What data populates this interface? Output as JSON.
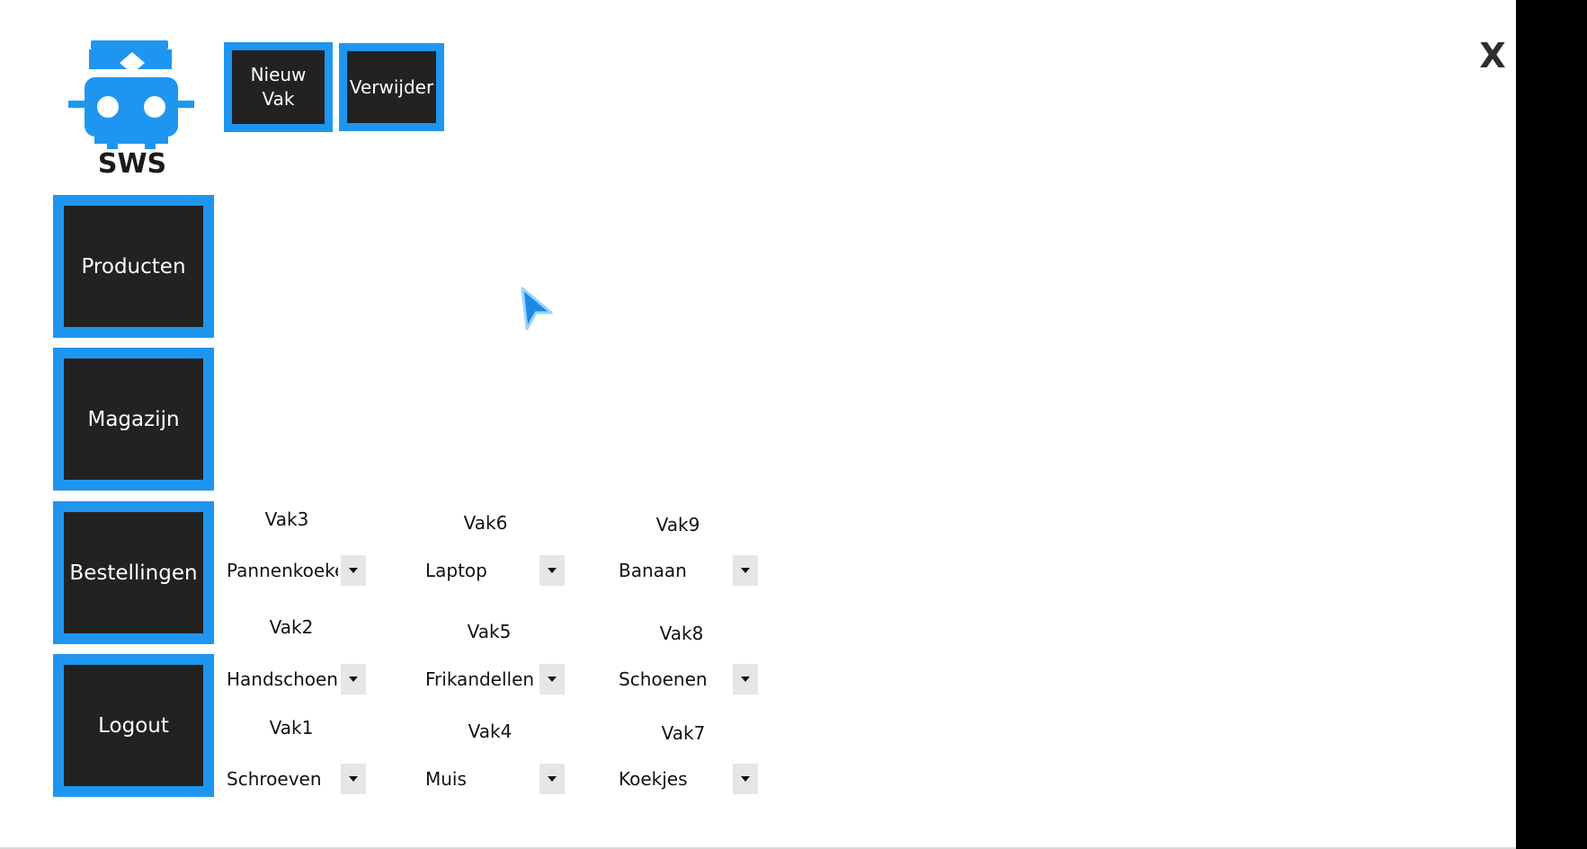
{
  "window": {
    "close_label": "X"
  },
  "logo": {
    "text": "SWS",
    "color": "#1e96f0"
  },
  "toolbar": {
    "new_vak_label": "Nieuw\nVak",
    "delete_label": "Verwijder"
  },
  "nav": {
    "items": [
      {
        "label": "Producten"
      },
      {
        "label": "Magazijn"
      },
      {
        "label": "Bestellingen"
      },
      {
        "label": "Logout"
      }
    ]
  },
  "vakken": [
    {
      "label": "Vak3",
      "value": "Pannenkoeken"
    },
    {
      "label": "Vak6",
      "value": "Laptop"
    },
    {
      "label": "Vak9",
      "value": "Banaan"
    },
    {
      "label": "Vak2",
      "value": "Handschoenen"
    },
    {
      "label": "Vak5",
      "value": "Frikandellen"
    },
    {
      "label": "Vak8",
      "value": "Schoenen"
    },
    {
      "label": "Vak1",
      "value": "Schroeven"
    },
    {
      "label": "Vak4",
      "value": "Muis"
    },
    {
      "label": "Vak7",
      "value": "Koekjes"
    }
  ],
  "colors": {
    "accent": "#1e96f0",
    "button_bg": "#222222"
  }
}
